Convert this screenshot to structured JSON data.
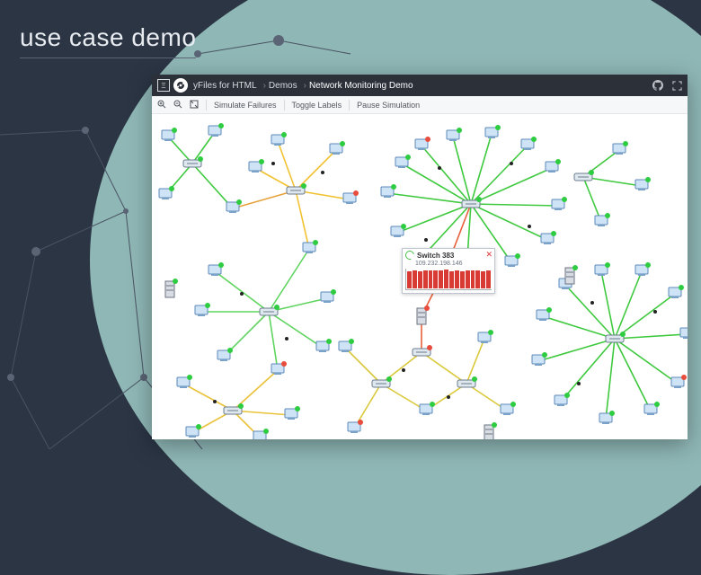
{
  "page": {
    "title": "use case demo"
  },
  "titlebar": {
    "product": "yFiles for HTML",
    "crumb1": "Demos",
    "crumb2": "Network Monitoring Demo"
  },
  "toolbar": {
    "zoom_in": "+",
    "zoom_out": "−",
    "fit": "⛶",
    "simulate": "Simulate Failures",
    "toggle_labels": "Toggle Labels",
    "pause": "Pause Simulation"
  },
  "tooltip": {
    "title": "Switch 383",
    "ip": "109.232.198.146",
    "load_bars": [
      0.92,
      0.95,
      0.9,
      0.96,
      0.93,
      0.97,
      0.94,
      0.98,
      0.9,
      0.95,
      0.92,
      0.96,
      0.93,
      0.97,
      0.9,
      0.95
    ]
  },
  "colors": {
    "edge_ok": "#4fd24f",
    "edge_warn": "#f4c430",
    "edge_bad": "#e8603c",
    "node_dot_ok": "#2ecc40",
    "node_dot_bad": "#e74c3c"
  }
}
